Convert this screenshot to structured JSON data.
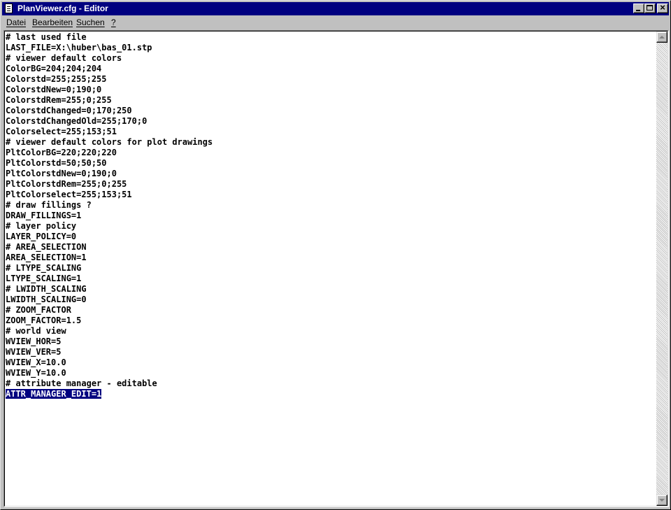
{
  "window": {
    "title": "PlanViewer.cfg - Editor"
  },
  "menu": {
    "items": [
      "Datei",
      "Bearbeiten",
      "Suchen",
      "?"
    ]
  },
  "editor": {
    "lines": [
      "# last used file",
      "LAST_FILE=X:\\huber\\bas_01.stp",
      "# viewer default colors",
      "ColorBG=204;204;204",
      "Colorstd=255;255;255",
      "ColorstdNew=0;190;0",
      "ColorstdRem=255;0;255",
      "ColorstdChanged=0;170;250",
      "ColorstdChangedOld=255;170;0",
      "Colorselect=255;153;51",
      "# viewer default colors for plot drawings",
      "PltColorBG=220;220;220",
      "PltColorstd=50;50;50",
      "PltColorstdNew=0;190;0",
      "PltColorstdRem=255;0;255",
      "PltColorselect=255;153;51",
      "# draw fillings ?",
      "DRAW_FILLINGS=1",
      "# layer policy",
      "LAYER_POLICY=0",
      "# AREA_SELECTION",
      "AREA_SELECTION=1",
      "# LTYPE_SCALING",
      "LTYPE_SCALING=1",
      "# LWIDTH_SCALING",
      "LWIDTH_SCALING=0",
      "# ZOOM_FACTOR",
      "ZOOM_FACTOR=1.5",
      "# world view",
      "WVIEW_HOR=5",
      "WVIEW_VER=5",
      "WVIEW_X=10.0",
      "WVIEW_Y=10.0",
      "# attribute manager - editable",
      "ATTR_MANAGER_EDIT=1"
    ],
    "selected_line": 34
  },
  "colors": {
    "titlebar": "#000080",
    "selection": "#000080",
    "face": "#c0c0c0"
  }
}
